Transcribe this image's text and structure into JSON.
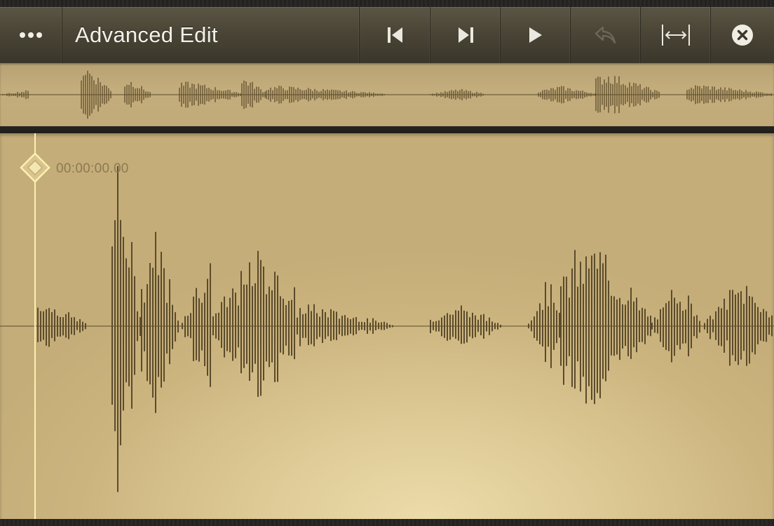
{
  "toolbar": {
    "title": "Advanced Edit",
    "menu_icon": "more-dots-icon",
    "buttons": [
      {
        "name": "skip-to-start",
        "icon": "skip-back-icon",
        "enabled": true
      },
      {
        "name": "skip-to-end",
        "icon": "skip-forward-icon",
        "enabled": true
      },
      {
        "name": "play",
        "icon": "play-icon",
        "enabled": true
      },
      {
        "name": "undo",
        "icon": "undo-icon",
        "enabled": false
      },
      {
        "name": "fit-to-width",
        "icon": "fit-width-icon",
        "enabled": true
      },
      {
        "name": "close",
        "icon": "close-icon",
        "enabled": true
      }
    ]
  },
  "timeline": {
    "playhead_time": "00:00:00.00"
  },
  "colors": {
    "toolbar": "#4a4536",
    "title_text": "#f3f1ea",
    "waveform": "#5b4b2b",
    "playhead": "#fbf0b4",
    "background_light": "#ecdcaa",
    "background_dark": "#c5ad79"
  }
}
